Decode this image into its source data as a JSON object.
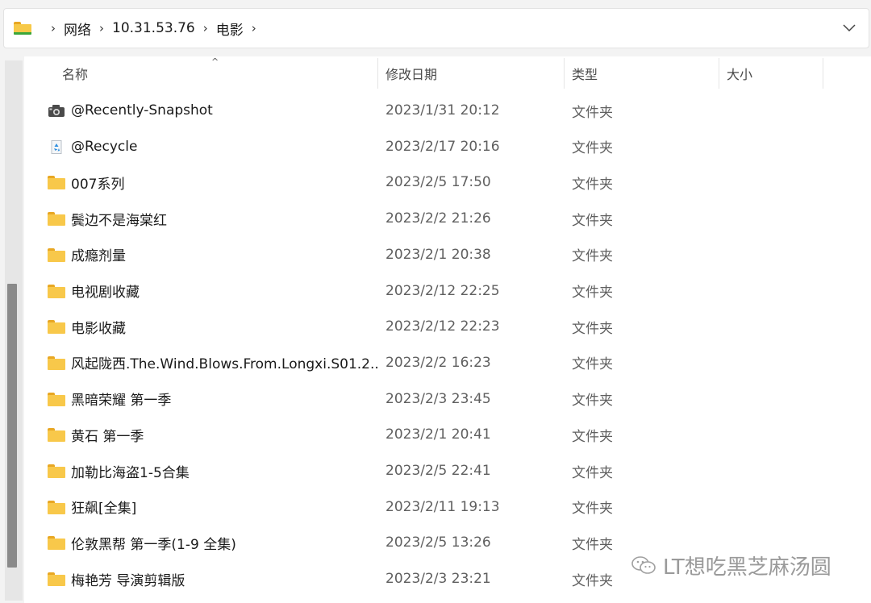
{
  "address_bar": {
    "crumbs": [
      "网络",
      "10.31.53.76",
      "电影"
    ],
    "separator": "›"
  },
  "columns": {
    "name": "名称",
    "date": "修改日期",
    "type": "类型",
    "size": "大小"
  },
  "sort_indicator": "^",
  "files": [
    {
      "name": "@Recently-Snapshot",
      "date": "2023/1/31 20:12",
      "type": "文件夹",
      "icon": "camera-icon"
    },
    {
      "name": "@Recycle",
      "date": "2023/2/17 20:16",
      "type": "文件夹",
      "icon": "recycle-icon"
    },
    {
      "name": "007系列",
      "date": "2023/2/5 17:50",
      "type": "文件夹",
      "icon": "folder-icon"
    },
    {
      "name": "鬓边不是海棠红",
      "date": "2023/2/2 21:26",
      "type": "文件夹",
      "icon": "folder-icon"
    },
    {
      "name": "成瘾剂量",
      "date": "2023/2/1 20:38",
      "type": "文件夹",
      "icon": "folder-icon"
    },
    {
      "name": "电视剧收藏",
      "date": "2023/2/12 22:25",
      "type": "文件夹",
      "icon": "folder-icon"
    },
    {
      "name": "电影收藏",
      "date": "2023/2/12 22:23",
      "type": "文件夹",
      "icon": "folder-icon"
    },
    {
      "name": "风起陇西.The.Wind.Blows.From.Longxi.S01.2...",
      "date": "2023/2/2 16:23",
      "type": "文件夹",
      "icon": "folder-icon"
    },
    {
      "name": "黑暗荣耀 第一季",
      "date": "2023/2/3 23:45",
      "type": "文件夹",
      "icon": "folder-icon"
    },
    {
      "name": "黄石 第一季",
      "date": "2023/2/1 20:41",
      "type": "文件夹",
      "icon": "folder-icon"
    },
    {
      "name": "加勒比海盗1-5合集",
      "date": "2023/2/5 22:41",
      "type": "文件夹",
      "icon": "folder-icon"
    },
    {
      "name": "狂飙[全集]",
      "date": "2023/2/11 19:13",
      "type": "文件夹",
      "icon": "folder-icon"
    },
    {
      "name": "伦敦黑帮 第一季(1-9 全集)",
      "date": "2023/2/5 13:26",
      "type": "文件夹",
      "icon": "folder-icon"
    },
    {
      "name": "梅艳芳 导演剪辑版",
      "date": "2023/2/3 23:21",
      "type": "文件夹",
      "icon": "folder-icon"
    }
  ],
  "watermark": "LT想吃黑芝麻汤圆",
  "colors": {
    "folder": "#f8c84a",
    "folder_tab": "#e8a723",
    "text": "#1a1a1a",
    "muted_text": "#5f5f5f",
    "chrome": "#f3f3f3"
  }
}
